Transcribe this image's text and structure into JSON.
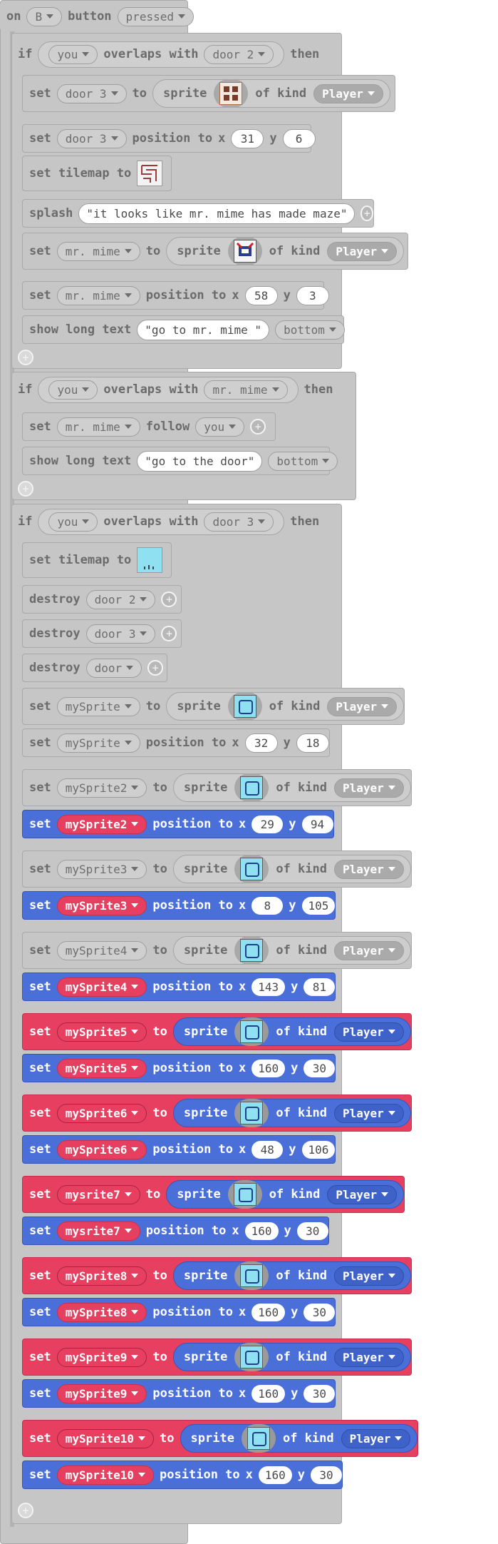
{
  "event": {
    "on": "on",
    "key": "B",
    "button": "button",
    "action": "pressed"
  },
  "blocks": {
    "kw_if": "if",
    "kw_then": "then",
    "kw_set": "set",
    "kw_to": "to",
    "kw_sprite": "sprite",
    "kw_of_kind": "of kind",
    "kw_position_to": "position to",
    "kw_x": "x",
    "kw_y": "y",
    "kw_overlaps": "overlaps with",
    "kw_set_tilemap": "set tilemap to",
    "kw_splash": "splash",
    "kw_show_long_text": "show long text",
    "kw_follow": "follow",
    "kw_destroy": "destroy",
    "kind": "Player"
  },
  "if1": {
    "a": "you",
    "b": "door 2",
    "set1_var": "door 3",
    "pos1_var": "door 3",
    "pos1_x": "31",
    "pos1_y": "6",
    "splash": "\"it looks like mr. mime has made maze\"",
    "set2_var": "mr. mime",
    "pos2_var": "mr. mime",
    "pos2_x": "58",
    "pos2_y": "3",
    "text": "\"go to  mr. mime \"",
    "text_pos": "bottom"
  },
  "if2": {
    "a": "you",
    "b": "mr. mime",
    "follow_var": "mr. mime",
    "follow_target": "you",
    "text": "\"go to the door\"",
    "text_pos": "bottom"
  },
  "if3": {
    "a": "you",
    "b": "door 3",
    "destroy1": "door 2",
    "destroy2": "door 3",
    "destroy3": "door",
    "rows": [
      {
        "type": "set",
        "style": "gray",
        "var": "mySprite"
      },
      {
        "type": "pos",
        "style": "gray",
        "var": "mySprite",
        "x": "32",
        "y": "18"
      },
      {
        "type": "set",
        "style": "gray",
        "var": "mySprite2"
      },
      {
        "type": "pos",
        "style": "blue",
        "var": "mySprite2",
        "x": "29",
        "y": "94"
      },
      {
        "type": "set",
        "style": "gray",
        "var": "mySprite3"
      },
      {
        "type": "pos",
        "style": "blue",
        "var": "mySprite3",
        "x": "8",
        "y": "105"
      },
      {
        "type": "set",
        "style": "gray",
        "var": "mySprite4"
      },
      {
        "type": "pos",
        "style": "blue",
        "var": "mySprite4",
        "x": "143",
        "y": "81"
      },
      {
        "type": "set",
        "style": "red",
        "var": "mySprite5"
      },
      {
        "type": "pos",
        "style": "blue",
        "var": "mySprite5",
        "x": "160",
        "y": "30"
      },
      {
        "type": "set",
        "style": "red",
        "var": "mySprite6"
      },
      {
        "type": "pos",
        "style": "blue",
        "var": "mySprite6",
        "x": "48",
        "y": "106"
      },
      {
        "type": "set",
        "style": "red",
        "var": "mysrite7"
      },
      {
        "type": "pos",
        "style": "blue",
        "var": "mysrite7",
        "x": "160",
        "y": "30"
      },
      {
        "type": "set",
        "style": "red",
        "var": "mySprite8"
      },
      {
        "type": "pos",
        "style": "blue",
        "var": "mySprite8",
        "x": "160",
        "y": "30"
      },
      {
        "type": "set",
        "style": "red",
        "var": "mySprite9"
      },
      {
        "type": "pos",
        "style": "blue",
        "var": "mySprite9",
        "x": "160",
        "y": "30"
      },
      {
        "type": "set",
        "style": "red",
        "var": "mySprite10"
      },
      {
        "type": "pos",
        "style": "blue",
        "var": "mySprite10",
        "x": "160",
        "y": "30"
      }
    ]
  },
  "icons": {
    "plus": "add-parameter-icon",
    "dropdown": "chevron-down-icon",
    "sprite_thumb": "sprite-image-icon",
    "tilemap_thumb": "tilemap-image-icon"
  },
  "colors": {
    "gray_block": "#c6c6c6",
    "blue_block": "#4a6fd8",
    "red_block": "#e63f5f",
    "sprite_fill": "#8fe0f0"
  }
}
